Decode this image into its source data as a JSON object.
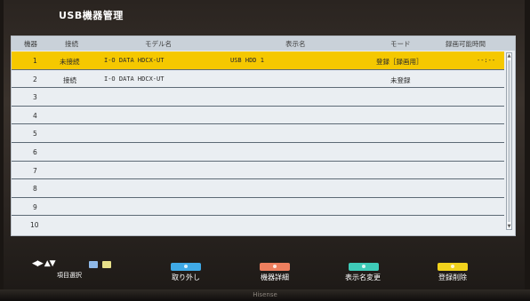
{
  "screen_title": "USB機器管理",
  "columns": {
    "device": "機器",
    "connection": "接続",
    "model": "モデル名",
    "display": "表示名",
    "mode": "モード",
    "record_time": "録画可能時間"
  },
  "rows": [
    {
      "num": "1",
      "connection": "未接続",
      "model": "I-O DATA HDCX-UT",
      "display": "USB HDD 1",
      "mode": "登録［録画用］",
      "time": "--:--",
      "selected": true
    },
    {
      "num": "2",
      "connection": "接続",
      "model": "I-O DATA HDCX-UT",
      "display": "",
      "mode": "未登録",
      "time": ""
    },
    {
      "num": "3"
    },
    {
      "num": "4"
    },
    {
      "num": "5"
    },
    {
      "num": "6"
    },
    {
      "num": "7"
    },
    {
      "num": "8"
    },
    {
      "num": "9"
    },
    {
      "num": "10"
    }
  ],
  "footer": {
    "nav_arrows": "◀▶ ▲▼",
    "nav_label": "項目選択",
    "buttons": [
      {
        "label": "取り外し",
        "color": "#3fa9e6"
      },
      {
        "label": "機器詳細",
        "color": "#ee7f5e"
      },
      {
        "label": "表示名変更",
        "color": "#3ecbb8"
      },
      {
        "label": "登録削除",
        "color": "#f1d21c"
      }
    ]
  },
  "brand": "Hisense",
  "colors": {
    "selected_row": "#f5c800",
    "panel_bg": "#eaeef2",
    "header_bg": "#c9d1d9"
  }
}
